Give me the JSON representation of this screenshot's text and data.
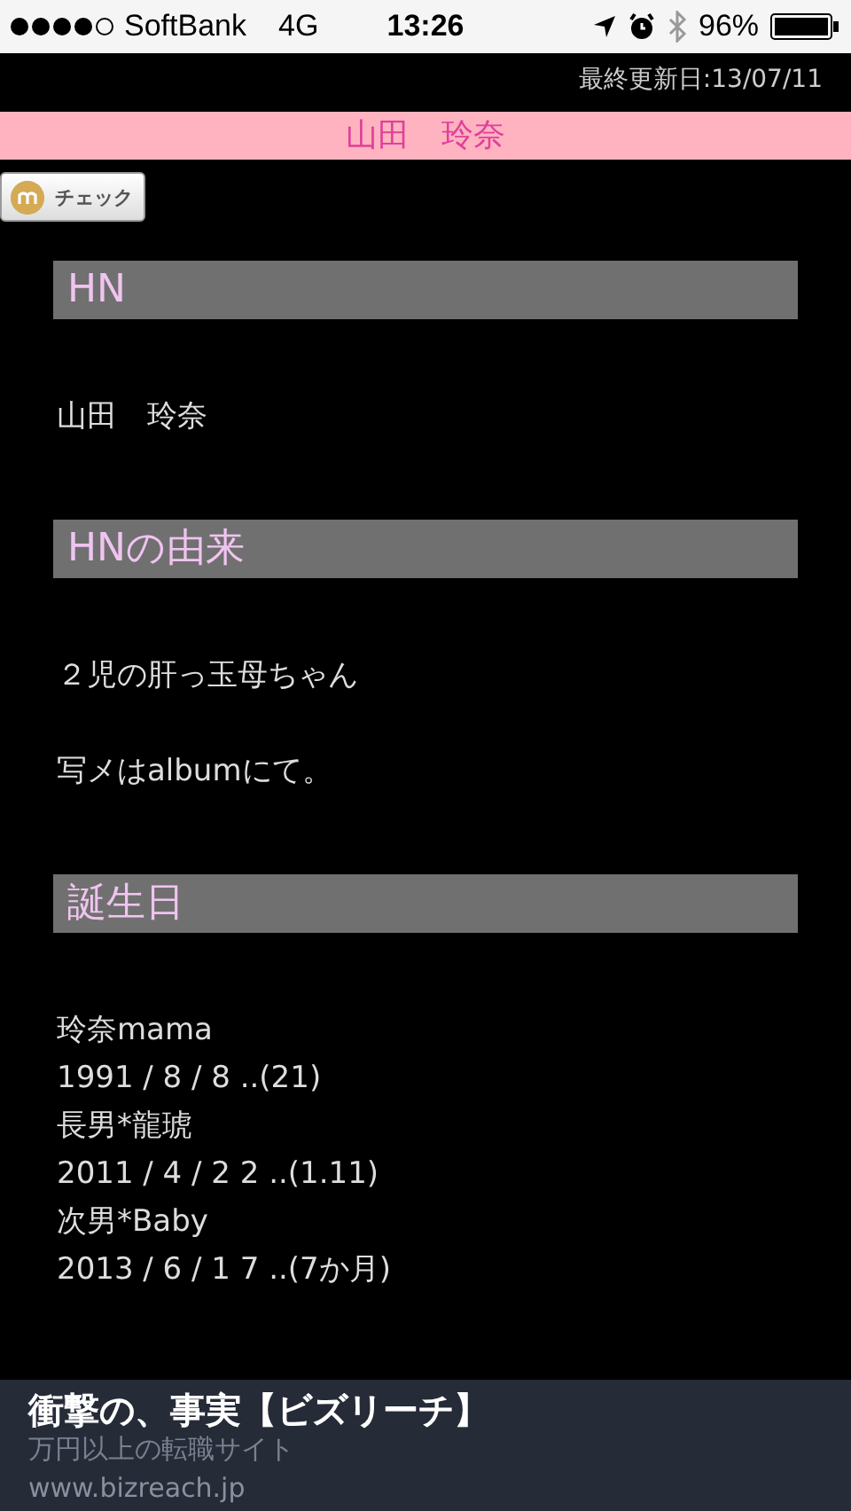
{
  "status_bar": {
    "carrier": "SoftBank",
    "network": "4G",
    "time": "13:26",
    "battery": "96%"
  },
  "last_updated": "最終更新日:13/07/11",
  "name_banner": "山田　玲奈",
  "check_button": "チェック",
  "sections": [
    {
      "heading": "HN",
      "paragraphs": [
        [
          "山田　玲奈"
        ]
      ]
    },
    {
      "heading": "HNの由来",
      "paragraphs": [
        [
          "２児の肝っ玉母ちゃん"
        ],
        [
          "写メはalbumにて。"
        ]
      ]
    },
    {
      "heading": "誕生日",
      "paragraphs": [
        [
          "玲奈mama",
          "1991 / 8 / 8 ..(21)",
          "長男*龍琥",
          "2011 / 4 / 2 2 ..(1.11)",
          "次男*Baby",
          "2013 / 6 / 1 7 ..(7か月)"
        ]
      ]
    }
  ],
  "ad": {
    "title": "衝撃の、事実【ビズリーチ】",
    "subtitle": "万円以上の転職サイト",
    "url": "www.bizreach.jp"
  }
}
